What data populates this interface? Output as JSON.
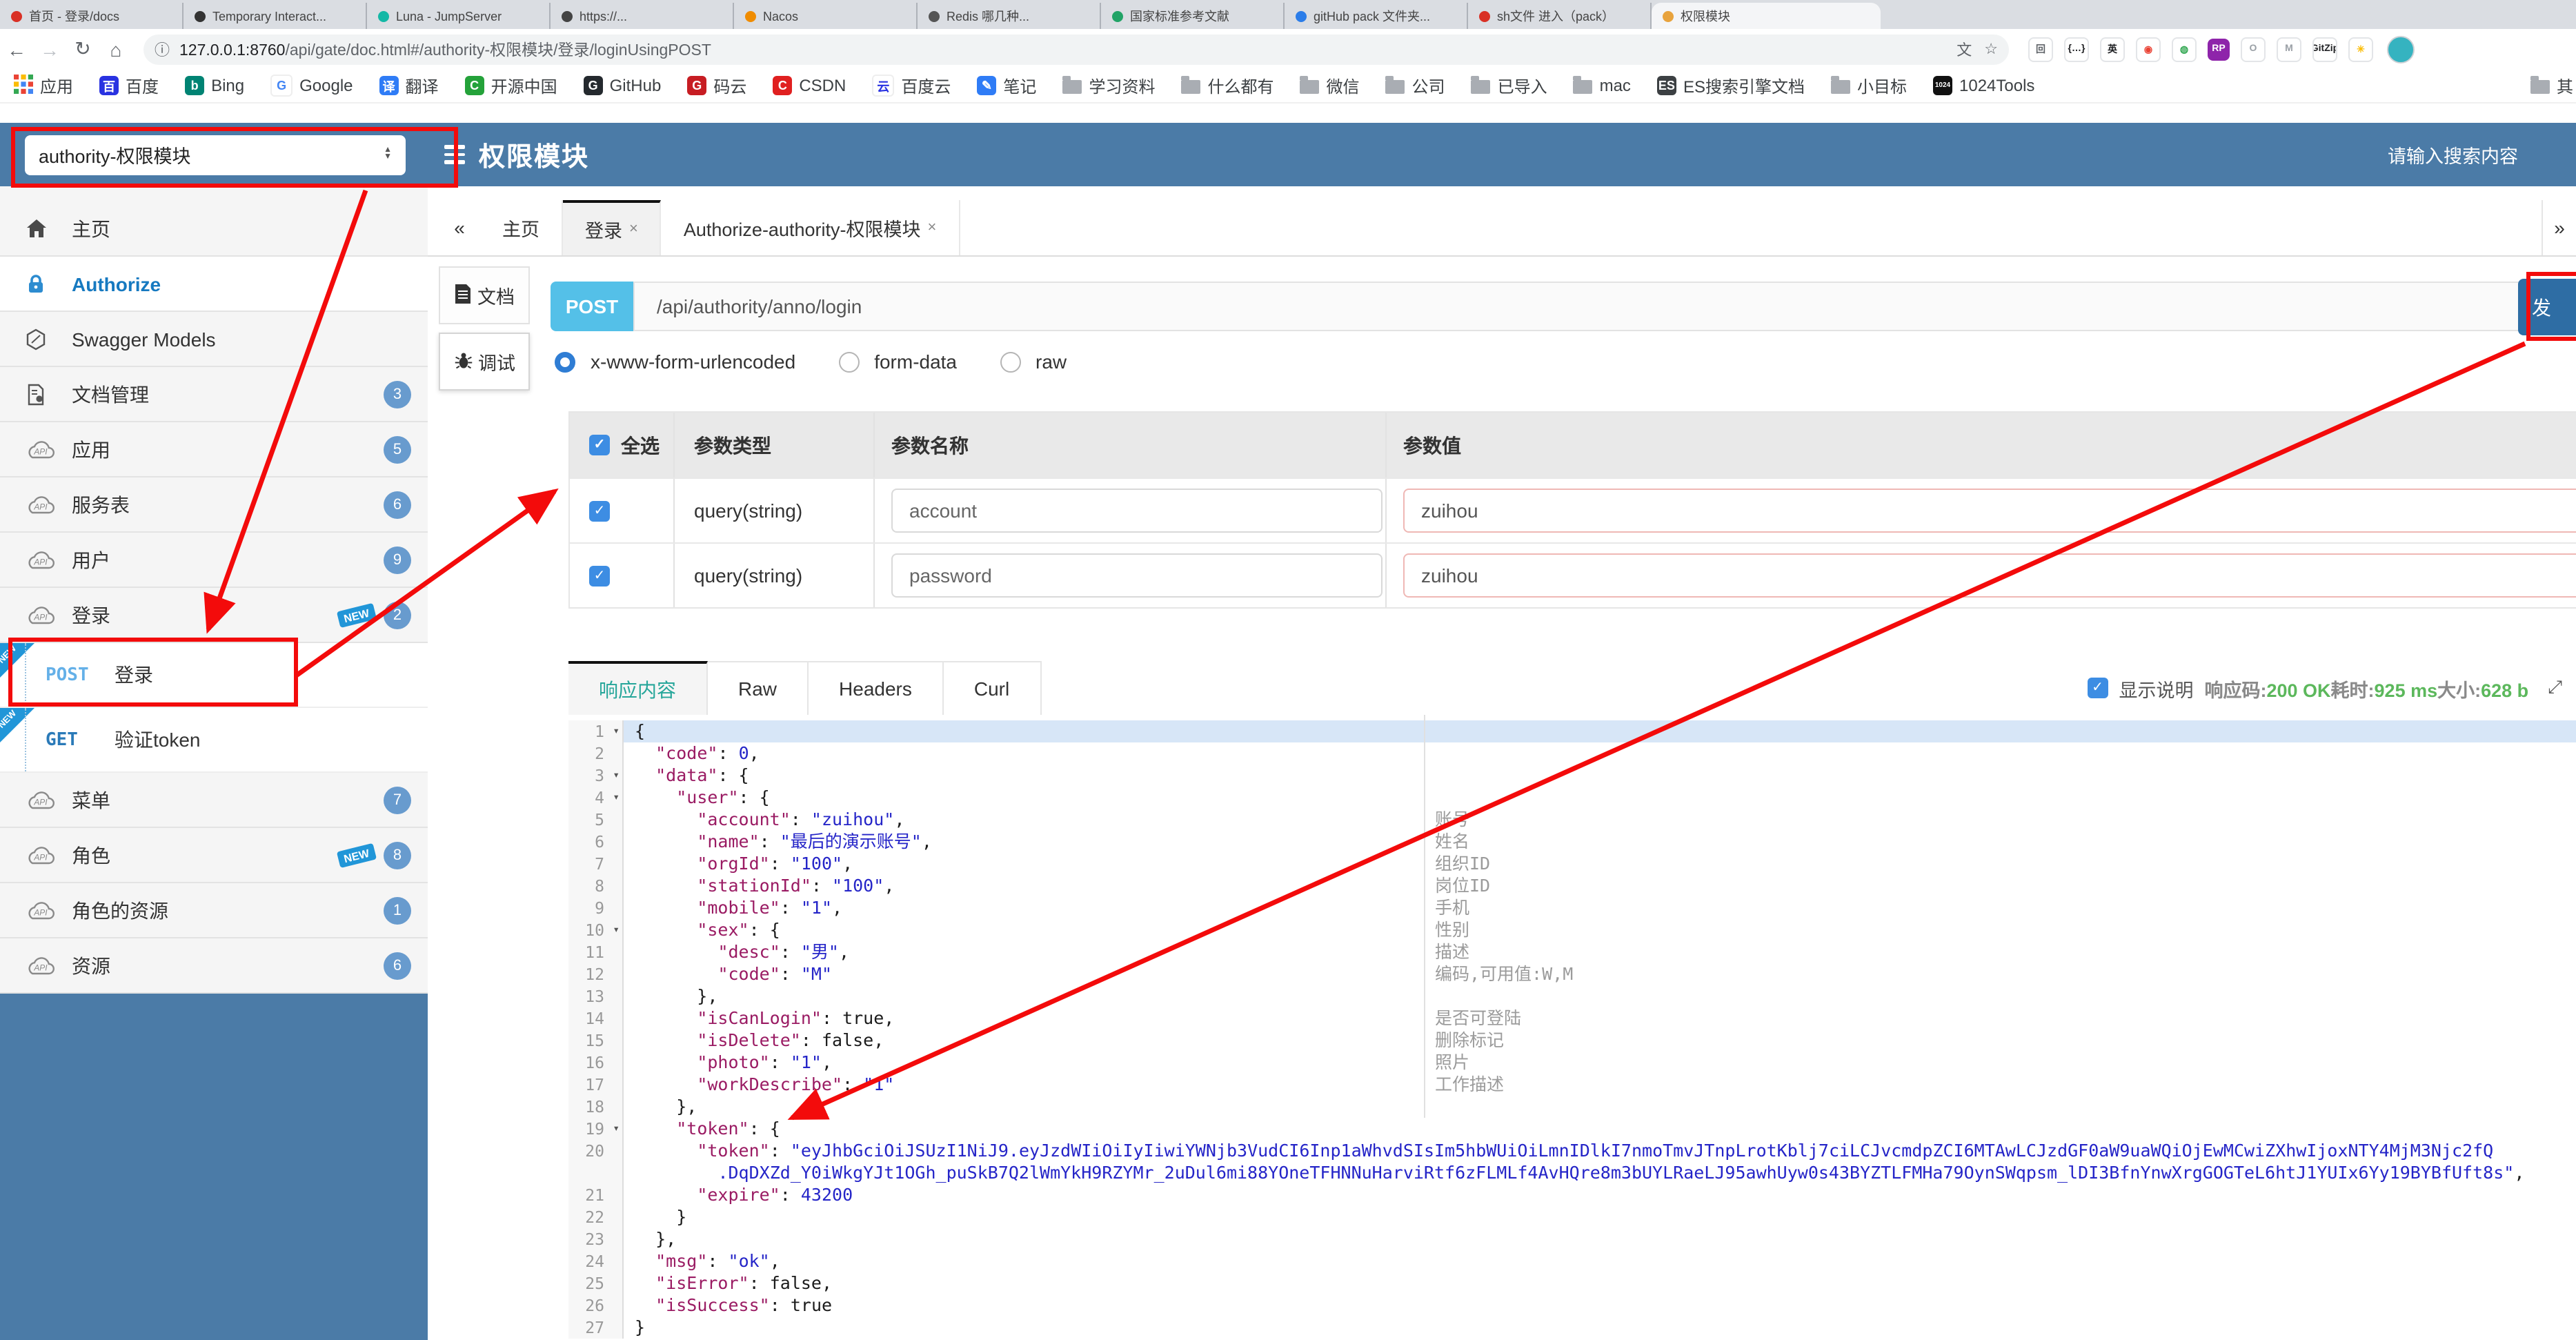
{
  "browser": {
    "tabs": [
      {
        "title": "首页 - 登录/docs",
        "fav": "#d93025"
      },
      {
        "title": "Temporary Interact...",
        "fav": "#333333"
      },
      {
        "title": "Luna - JumpServer",
        "fav": "#14b8a6"
      },
      {
        "title": "https://...",
        "fav": "#444444"
      },
      {
        "title": "Nacos",
        "fav": "#f08c00"
      },
      {
        "title": "Redis 哪几种...",
        "fav": "#555555"
      },
      {
        "title": "国家标准参考文献",
        "fav": "#21a366"
      },
      {
        "title": "gitHub pack 文件夹...",
        "fav": "#2b7de9"
      },
      {
        "title": "sh文件 进入（pack）",
        "fav": "#d93025"
      },
      {
        "title": "权限模块",
        "fav": "#e8a33d",
        "active": true
      }
    ],
    "nav_icons": {
      "back": "←",
      "forward": "→",
      "reload": "↻",
      "home": "⌂"
    },
    "url_host": "127.0.0.1:8760",
    "url_rest": "/api/gate/doc.html#/authority-权限模块/登录/loginUsingPOST",
    "info_icon": "ⓘ",
    "translate_icon": "文",
    "star_icon": "☆",
    "extensions": [
      {
        "ch": "回",
        "bg": "#ffffff",
        "fg": "#5f6368"
      },
      {
        "ch": "{…}",
        "bg": "#ffffff",
        "fg": "#202124"
      },
      {
        "ch": "英",
        "bg": "#ffffff",
        "fg": "#202124"
      },
      {
        "ch": "◉",
        "bg": "#ffffff",
        "fg": "#ea4335"
      },
      {
        "ch": "◍",
        "bg": "#ffffff",
        "fg": "#34a853"
      },
      {
        "ch": "RP",
        "bg": "#8e24aa",
        "fg": "#ffffff"
      },
      {
        "ch": "O",
        "bg": "#ffffff",
        "fg": "#9aa0a6"
      },
      {
        "ch": "M",
        "bg": "#ffffff",
        "fg": "#9aa0a6"
      },
      {
        "ch": "GitZip",
        "bg": "#ffffff",
        "fg": "#202124"
      },
      {
        "ch": "✳",
        "bg": "#ffffff",
        "fg": "#fbbc04"
      }
    ],
    "bookmarks": [
      {
        "label": "应用",
        "icon": "grid"
      },
      {
        "label": "百度",
        "icon": "letter",
        "ch": "百",
        "bg": "#2932e1"
      },
      {
        "label": "Bing",
        "icon": "letter",
        "ch": "b",
        "bg": "#008373"
      },
      {
        "label": "Google",
        "icon": "letter",
        "ch": "G",
        "bg": "#ffffff",
        "fg": "#4285f4"
      },
      {
        "label": "翻译",
        "icon": "letter",
        "ch": "译",
        "bg": "#2f7cf6"
      },
      {
        "label": "开源中国",
        "icon": "letter",
        "ch": "C",
        "bg": "#24a23a"
      },
      {
        "label": "GitHub",
        "icon": "letter",
        "ch": "G",
        "bg": "#24292e"
      },
      {
        "label": "码云",
        "icon": "letter",
        "ch": "G",
        "bg": "#c71d23"
      },
      {
        "label": "CSDN",
        "icon": "letter",
        "ch": "C",
        "bg": "#e02020"
      },
      {
        "label": "百度云",
        "icon": "letter",
        "ch": "云",
        "bg": "#ffffff",
        "fg": "#2932e1"
      },
      {
        "label": "笔记",
        "icon": "letter",
        "ch": "✎",
        "bg": "#2f7cf6"
      },
      {
        "label": "学习资料",
        "icon": "folder"
      },
      {
        "label": "什么都有",
        "icon": "folder"
      },
      {
        "label": "微信",
        "icon": "folder"
      },
      {
        "label": "公司",
        "icon": "folder"
      },
      {
        "label": "已导入",
        "icon": "folder"
      },
      {
        "label": "mac",
        "icon": "folder"
      },
      {
        "label": "ES搜索引擎文档",
        "icon": "letter",
        "ch": "ES",
        "bg": "#3c4043"
      },
      {
        "label": "小目标",
        "icon": "folder"
      },
      {
        "label": "1024Tools",
        "icon": "letter",
        "ch": "1024",
        "bg": "#111111"
      },
      {
        "label": "其",
        "icon": "folder",
        "last": true
      }
    ]
  },
  "header": {
    "module_select": "authority-权限模块",
    "title": "权限模块",
    "search_placeholder": "请输入搜索内容"
  },
  "sidebar": {
    "items": [
      {
        "icon": "home",
        "label": "主页"
      },
      {
        "icon": "lock",
        "label": "Authorize",
        "selected": true
      },
      {
        "icon": "hex",
        "label": "Swagger Models"
      },
      {
        "icon": "docgear",
        "label": "文档管理",
        "badge": "3"
      },
      {
        "icon": "cloud",
        "label": "应用",
        "badge": "5"
      },
      {
        "icon": "cloud",
        "label": "服务表",
        "badge": "6"
      },
      {
        "icon": "cloud",
        "label": "用户",
        "badge": "9"
      },
      {
        "icon": "cloud",
        "label": "登录",
        "badge": "2",
        "new": true
      },
      {
        "type": "op",
        "method": "POST",
        "label": "登录",
        "new": true
      },
      {
        "type": "op",
        "method": "GET",
        "label": "验证token",
        "new": true
      },
      {
        "icon": "cloud",
        "label": "菜单",
        "badge": "7"
      },
      {
        "icon": "cloud",
        "label": "角色",
        "badge": "8",
        "new": true
      },
      {
        "icon": "cloud",
        "label": "角色的资源",
        "badge": "1"
      },
      {
        "icon": "cloud",
        "label": "资源",
        "badge": "6"
      }
    ]
  },
  "tabs": {
    "collapse_left": "«",
    "collapse_right": "»",
    "items": [
      {
        "label": "主页"
      },
      {
        "label": "登录",
        "close": "×",
        "active": true
      },
      {
        "label": "Authorize-authority-权限模块",
        "close": "×"
      }
    ]
  },
  "doc_tabs": [
    {
      "label": "文档",
      "icon": "doc"
    },
    {
      "label": "调试",
      "icon": "bug",
      "active": true
    }
  ],
  "request": {
    "method": "POST",
    "path": "/api/authority/anno/login",
    "send_label": "发",
    "body_types": [
      "x-www-form-urlencoded",
      "form-data",
      "raw"
    ],
    "body_type_selected": 0
  },
  "params": {
    "headers": [
      "全选",
      "参数类型",
      "参数名称",
      "参数值"
    ],
    "rows": [
      {
        "checked": true,
        "type": "query(string)",
        "name": "account",
        "value": "zuihou"
      },
      {
        "checked": true,
        "type": "query(string)",
        "name": "password",
        "value": "zuihou"
      }
    ]
  },
  "response": {
    "tabs": [
      "响应内容",
      "Raw",
      "Headers",
      "Curl"
    ],
    "active_tab": 0,
    "show_desc_label": "显示说明",
    "show_desc_checked": true,
    "status_items": [
      {
        "label": "响应码:",
        "value": "200 OK"
      },
      {
        "label": "耗时:",
        "value": "925 ms"
      },
      {
        "label": "大小:",
        "value": "628 b"
      }
    ],
    "code_lines": [
      {
        "n": 1,
        "fold": true,
        "hl": true,
        "seg": [
          [
            "{",
            "p"
          ]
        ]
      },
      {
        "n": 2,
        "seg": [
          [
            "  ",
            "p"
          ],
          [
            "\"code\"",
            "k"
          ],
          [
            ": ",
            "p"
          ],
          [
            "0",
            "n"
          ],
          [
            ",",
            "p"
          ]
        ]
      },
      {
        "n": 3,
        "fold": true,
        "seg": [
          [
            "  ",
            "p"
          ],
          [
            "\"data\"",
            "k"
          ],
          [
            ": {",
            "p"
          ]
        ]
      },
      {
        "n": 4,
        "fold": true,
        "seg": [
          [
            "    ",
            "p"
          ],
          [
            "\"user\"",
            "k"
          ],
          [
            ": {",
            "p"
          ]
        ]
      },
      {
        "n": 5,
        "ann": "账号",
        "seg": [
          [
            "      ",
            "p"
          ],
          [
            "\"account\"",
            "k"
          ],
          [
            ": ",
            "p"
          ],
          [
            "\"zuihou\"",
            "s"
          ],
          [
            ",",
            "p"
          ]
        ]
      },
      {
        "n": 6,
        "ann": "姓名",
        "seg": [
          [
            "      ",
            "p"
          ],
          [
            "\"name\"",
            "k"
          ],
          [
            ": ",
            "p"
          ],
          [
            "\"最后的演示账号\"",
            "s"
          ],
          [
            ",",
            "p"
          ]
        ]
      },
      {
        "n": 7,
        "ann": "组织ID",
        "seg": [
          [
            "      ",
            "p"
          ],
          [
            "\"orgId\"",
            "k"
          ],
          [
            ": ",
            "p"
          ],
          [
            "\"100\"",
            "s"
          ],
          [
            ",",
            "p"
          ]
        ]
      },
      {
        "n": 8,
        "ann": "岗位ID",
        "seg": [
          [
            "      ",
            "p"
          ],
          [
            "\"stationId\"",
            "k"
          ],
          [
            ": ",
            "p"
          ],
          [
            "\"100\"",
            "s"
          ],
          [
            ",",
            "p"
          ]
        ]
      },
      {
        "n": 9,
        "ann": "手机",
        "seg": [
          [
            "      ",
            "p"
          ],
          [
            "\"mobile\"",
            "k"
          ],
          [
            ": ",
            "p"
          ],
          [
            "\"1\"",
            "s"
          ],
          [
            ",",
            "p"
          ]
        ]
      },
      {
        "n": 10,
        "fold": true,
        "ann": "性别",
        "seg": [
          [
            "      ",
            "p"
          ],
          [
            "\"sex\"",
            "k"
          ],
          [
            ": {",
            "p"
          ]
        ]
      },
      {
        "n": 11,
        "ann": "描述",
        "seg": [
          [
            "        ",
            "p"
          ],
          [
            "\"desc\"",
            "k"
          ],
          [
            ": ",
            "p"
          ],
          [
            "\"男\"",
            "s"
          ],
          [
            ",",
            "p"
          ]
        ]
      },
      {
        "n": 12,
        "ann": "编码,可用值:W,M",
        "seg": [
          [
            "        ",
            "p"
          ],
          [
            "\"code\"",
            "k"
          ],
          [
            ": ",
            "p"
          ],
          [
            "\"M\"",
            "s"
          ]
        ]
      },
      {
        "n": 13,
        "seg": [
          [
            "      },",
            "p"
          ]
        ]
      },
      {
        "n": 14,
        "ann": "是否可登陆",
        "seg": [
          [
            "      ",
            "p"
          ],
          [
            "\"isCanLogin\"",
            "k"
          ],
          [
            ": ",
            "p"
          ],
          [
            "true",
            "b"
          ],
          [
            ",",
            "p"
          ]
        ]
      },
      {
        "n": 15,
        "ann": "删除标记",
        "seg": [
          [
            "      ",
            "p"
          ],
          [
            "\"isDelete\"",
            "k"
          ],
          [
            ": ",
            "p"
          ],
          [
            "false",
            "b"
          ],
          [
            ",",
            "p"
          ]
        ]
      },
      {
        "n": 16,
        "ann": "照片",
        "seg": [
          [
            "      ",
            "p"
          ],
          [
            "\"photo\"",
            "k"
          ],
          [
            ": ",
            "p"
          ],
          [
            "\"1\"",
            "s"
          ],
          [
            ",",
            "p"
          ]
        ]
      },
      {
        "n": 17,
        "ann": "工作描述",
        "seg": [
          [
            "      ",
            "p"
          ],
          [
            "\"workDescribe\"",
            "k"
          ],
          [
            ": ",
            "p"
          ],
          [
            "\"1\"",
            "s"
          ]
        ]
      },
      {
        "n": 18,
        "seg": [
          [
            "    },",
            "p"
          ]
        ]
      },
      {
        "n": 19,
        "fold": true,
        "seg": [
          [
            "    ",
            "p"
          ],
          [
            "\"token\"",
            "k"
          ],
          [
            ": {",
            "p"
          ]
        ]
      },
      {
        "n": 20,
        "seg": [
          [
            "      ",
            "p"
          ],
          [
            "\"token\"",
            "k"
          ],
          [
            ": ",
            "p"
          ],
          [
            "\"eyJhbGciOiJSUzI1NiJ9.eyJzdWIiOiIyIiwiYWNjb3VudCI6Inp1aWhvdSIsIm5hbWUiOiLmnIDlkI7nmoTmvJTnpLrotKblj7ciLCJvcmdpZCI6MTAwLCJzdGF0aW9uaWQiOjEwMCwiZXhwIjoxNTY4MjM3Njc2fQ",
            "s"
          ]
        ],
        "seg2": [
          [
            "        ",
            "p"
          ],
          [
            ".DqDXZd_Y0iWkgYJt1OGh_puSkB7Q2lWmYkH9RZYMr_2uDul6mi88YOneTFHNNuHarviRtf6zFLMLf4AvHQre8m3bUYLRaeLJ95awhUyw0s43BYZTLFMHa79OynSWqpsm_lDI3BfnYnwXrgGOGTeL6htJ1YUIx6Yy19BYBfUft8s\"",
            "s"
          ],
          [
            ",",
            "p"
          ]
        ]
      },
      {
        "n": 21,
        "seg": [
          [
            "      ",
            "p"
          ],
          [
            "\"expire\"",
            "k"
          ],
          [
            ": ",
            "p"
          ],
          [
            "43200",
            "n"
          ]
        ]
      },
      {
        "n": 22,
        "seg": [
          [
            "    }",
            "p"
          ]
        ]
      },
      {
        "n": 23,
        "seg": [
          [
            "  },",
            "p"
          ]
        ]
      },
      {
        "n": 24,
        "seg": [
          [
            "  ",
            "p"
          ],
          [
            "\"msg\"",
            "k"
          ],
          [
            ": ",
            "p"
          ],
          [
            "\"ok\"",
            "s"
          ],
          [
            ",",
            "p"
          ]
        ]
      },
      {
        "n": 25,
        "seg": [
          [
            "  ",
            "p"
          ],
          [
            "\"isError\"",
            "k"
          ],
          [
            ": ",
            "p"
          ],
          [
            "false",
            "b"
          ],
          [
            ",",
            "p"
          ]
        ]
      },
      {
        "n": 26,
        "seg": [
          [
            "  ",
            "p"
          ],
          [
            "\"isSuccess\"",
            "k"
          ],
          [
            ": ",
            "p"
          ],
          [
            "true",
            "b"
          ]
        ]
      },
      {
        "n": 27,
        "seg": [
          [
            "}",
            "p"
          ]
        ]
      }
    ]
  },
  "annotations": {
    "color": "#f30b0b"
  }
}
